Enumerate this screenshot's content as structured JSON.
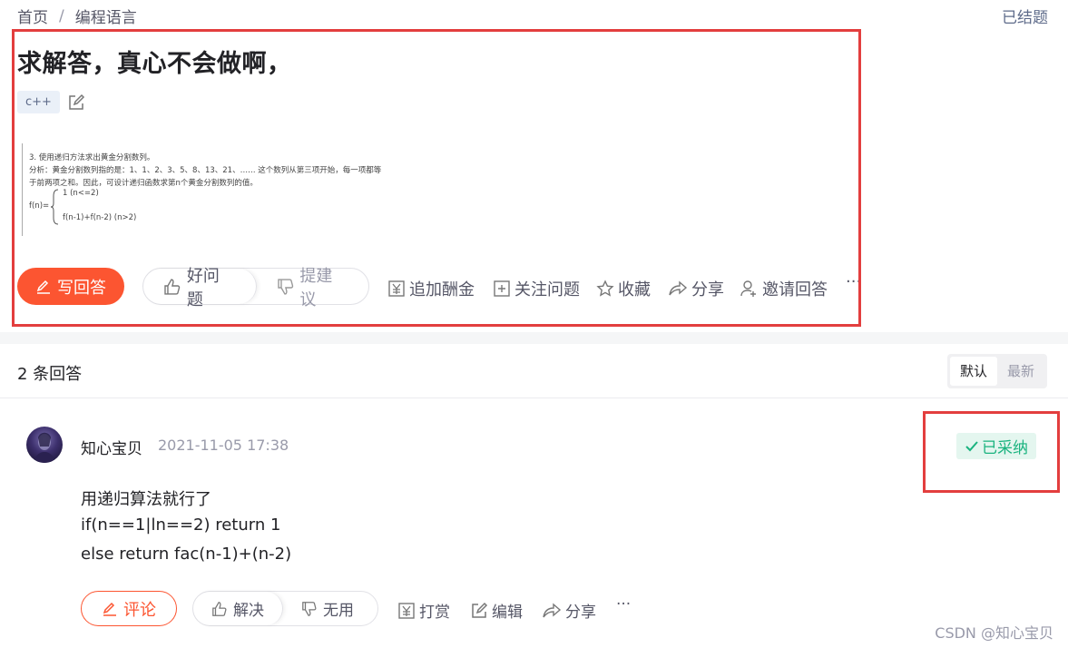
{
  "breadcrumb": {
    "home": "首页",
    "separator": "/",
    "category": "编程语言"
  },
  "status_label": "已结题",
  "question": {
    "title": "求解答，真心不会做啊，",
    "tag": "c++",
    "figure_lines": [
      "3. 使用递归方法求出黄金分割数列。",
      "分析：黄金分割数列指的是：1、1、2、3、5、8、13、21、…… 这个数列从第三项开始，每一项都等",
      "于前两项之和。因此，可设计递归函数求第n个黄金分割数列的值。",
      "1                    (n<=2)",
      "f(n)=",
      "f(n-1)+f(n-2)     (n>2)"
    ]
  },
  "actions": {
    "write_answer": "写回答",
    "good_question": "好问题",
    "suggest": "提建议",
    "add_bounty": "追加酬金",
    "follow": "关注问题",
    "favorite": "收藏",
    "share": "分享",
    "invite": "邀请回答",
    "more": "···"
  },
  "answers_header": {
    "count": "2 条回答",
    "sort_default": "默认",
    "sort_newest": "最新"
  },
  "answer": {
    "author": "知心宝贝",
    "date": "2021-11-05 17:38",
    "accepted": "已采纳",
    "lines": [
      "用递归算法就行了",
      "if(n==1|ln==2) return 1",
      "else return fac(n-1)+(n-2)"
    ],
    "comment": "评论",
    "solved": "解决",
    "useless": "无用",
    "tip": "打赏",
    "edit": "编辑",
    "share": "分享",
    "more": "···"
  },
  "watermark": "CSDN @知心宝贝",
  "colors": {
    "accent": "#fc5531",
    "accepted": "#1ab37f",
    "highlight_box": "#e33e3e"
  }
}
